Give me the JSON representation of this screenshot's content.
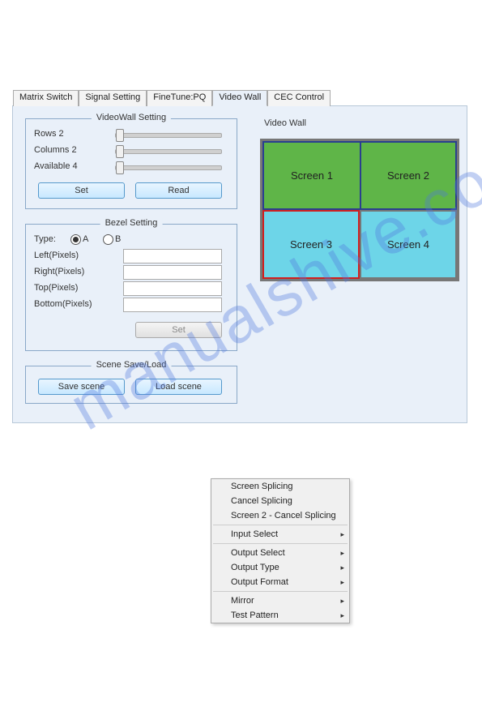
{
  "tabs": {
    "matrix_switch": "Matrix Switch",
    "signal_setting": "Signal Setting",
    "finetune_pq": "FineTune:PQ",
    "video_wall": "Video Wall",
    "cec_control": "CEC Control"
  },
  "videowall_setting": {
    "title": "VideoWall Setting",
    "rows_label": "Rows 2",
    "columns_label": "Columns 2",
    "available_label": "Available 4",
    "set_btn": "Set",
    "read_btn": "Read"
  },
  "bezel_setting": {
    "title": "Bezel Setting",
    "type_label": "Type:",
    "radio_a": "A",
    "radio_b": "B",
    "left_label": "Left(Pixels)",
    "right_label": "Right(Pixels)",
    "top_label": "Top(Pixels)",
    "bottom_label": "Bottom(Pixels)",
    "set_btn": "Set"
  },
  "scene": {
    "title": "Scene Save/Load",
    "save_btn": "Save scene",
    "load_btn": "Load scene"
  },
  "videowall_preview": {
    "title": "Video Wall",
    "screen1": "Screen 1",
    "screen2": "Screen 2",
    "screen3": "Screen 3",
    "screen4": "Screen 4"
  },
  "context_menu": {
    "screen_splicing": "Screen Splicing",
    "cancel_splicing": "Cancel Splicing",
    "screen2_cancel": "Screen 2 - Cancel Splicing",
    "input_select": "Input Select",
    "output_select": "Output Select",
    "output_type": "Output Type",
    "output_format": "Output Format",
    "mirror": "Mirror",
    "test_pattern": "Test Pattern"
  },
  "watermark": "manualshive.com"
}
